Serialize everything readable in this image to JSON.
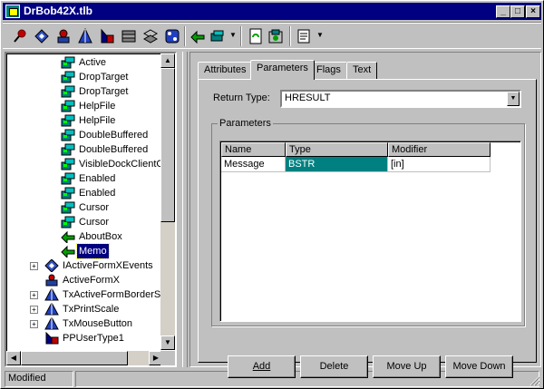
{
  "window": {
    "title": "DrBob42X.tlb"
  },
  "titlebar_buttons": [
    "minimize",
    "maximize",
    "close"
  ],
  "toolbar": {
    "icons": [
      "pin-icon",
      "interface-icon",
      "dispinterface-icon",
      "coclass-icon",
      "enum-icon",
      "record-icon",
      "union-icon",
      "module-icon",
      "method-icon",
      "property-icon",
      "refresh-icon",
      "register-icon",
      "export-icon"
    ]
  },
  "tree": {
    "nodes": [
      {
        "label": "Active",
        "icon": "property-icon",
        "level": 2
      },
      {
        "label": "DropTarget",
        "icon": "property-icon",
        "level": 2
      },
      {
        "label": "DropTarget",
        "icon": "property-icon",
        "level": 2
      },
      {
        "label": "HelpFile",
        "icon": "property-icon",
        "level": 2
      },
      {
        "label": "HelpFile",
        "icon": "property-icon",
        "level": 2
      },
      {
        "label": "DoubleBuffered",
        "icon": "property-icon",
        "level": 2
      },
      {
        "label": "DoubleBuffered",
        "icon": "property-icon",
        "level": 2
      },
      {
        "label": "VisibleDockClientCount",
        "icon": "property-icon",
        "level": 2
      },
      {
        "label": "Enabled",
        "icon": "property-icon",
        "level": 2
      },
      {
        "label": "Enabled",
        "icon": "property-icon",
        "level": 2
      },
      {
        "label": "Cursor",
        "icon": "property-icon",
        "level": 2
      },
      {
        "label": "Cursor",
        "icon": "property-icon",
        "level": 2
      },
      {
        "label": "AboutBox",
        "icon": "method-icon",
        "level": 2
      },
      {
        "label": "Memo",
        "icon": "method-icon",
        "level": 2,
        "selected": true
      },
      {
        "label": "IActiveFormXEvents",
        "icon": "dispinterface-icon",
        "level": 1,
        "expander": "+"
      },
      {
        "label": "ActiveFormX",
        "icon": "coclass-icon",
        "level": 1
      },
      {
        "label": "TxActiveFormBorderStyle",
        "icon": "enum-icon",
        "level": 1,
        "expander": "+"
      },
      {
        "label": "TxPrintScale",
        "icon": "enum-icon",
        "level": 1,
        "expander": "+"
      },
      {
        "label": "TxMouseButton",
        "icon": "enum-icon",
        "level": 1,
        "expander": "+"
      },
      {
        "label": "PPUserType1",
        "icon": "alias-icon",
        "level": 1
      }
    ]
  },
  "tabs": [
    {
      "label": "Attributes",
      "active": false
    },
    {
      "label": "Parameters",
      "active": true
    },
    {
      "label": "Flags",
      "active": false
    },
    {
      "label": "Text",
      "active": false
    }
  ],
  "parameters_page": {
    "return_type_label": "Return Type:",
    "return_type_value": "HRESULT",
    "group_title": "Parameters",
    "columns": [
      "Name",
      "Type",
      "Modifier"
    ],
    "rows": [
      {
        "name": "Message",
        "type": "BSTR",
        "modifier": "[in]"
      }
    ],
    "buttons": {
      "add": "Add",
      "delete": "Delete",
      "move_up": "Move Up",
      "move_down": "Move Down"
    }
  },
  "status": {
    "text": "Modified"
  },
  "colors": {
    "title_bar": "#000080",
    "selection": "#000080",
    "cell_highlight": "#008080",
    "face": "#c0c0c0"
  }
}
